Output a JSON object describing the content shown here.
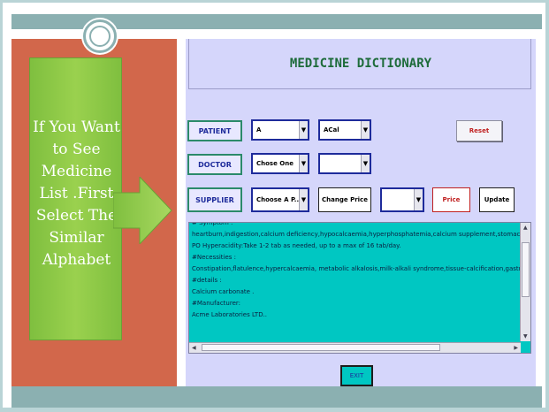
{
  "slide": {
    "instruction_text": "If You Want to See Medicine List .First Select The Similar Alphabet"
  },
  "app": {
    "title": "MEDICINE DICTIONARY",
    "patient": {
      "label": "PATIENT",
      "letter": "A",
      "medicine": "ACal"
    },
    "doctor": {
      "label": "DOCTOR",
      "selected": "Chose One",
      "second": ""
    },
    "supplier": {
      "label": "SUPPLIER",
      "selected": "Choose A P...",
      "change_price": "Change Price",
      "third": "",
      "price": "Price",
      "update": "Update"
    },
    "reset": "Reset",
    "exit": "EXIT",
    "details": [
      "# Symptom :",
      "heartburn,indigestion,calcium deficiency,hypocalcaemia,hyperphosphatemia,calcium supplement,stomach upset",
      "PO Hyperacidity:Take 1-2 tab as needed, up to a max of 16 tab/day.",
      "#Necessities :",
      "Constipation,flatulence,hypercalcaemia, metabolic alkalosis,milk-alkali syndrome,tissue-calcification,gastric",
      "#details :",
      "Calcium carbonate .",
      "#Manufacturer:",
      " Acme Laboratories LTD.."
    ]
  }
}
